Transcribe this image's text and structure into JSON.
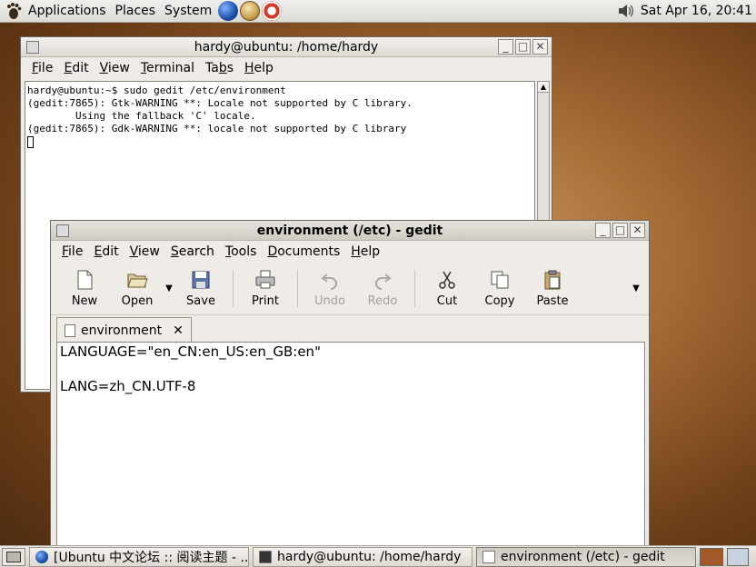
{
  "top_panel": {
    "menus": [
      "Applications",
      "Places",
      "System"
    ],
    "clock": "Sat Apr 16, 20:41"
  },
  "terminal": {
    "title": "hardy@ubuntu: /home/hardy",
    "menus": [
      {
        "label": "File",
        "key": "F",
        "rest": "ile"
      },
      {
        "label": "Edit",
        "key": "E",
        "rest": "dit"
      },
      {
        "label": "View",
        "key": "V",
        "rest": "iew"
      },
      {
        "label": "Terminal",
        "key": "T",
        "rest": "erminal"
      },
      {
        "label": "Tabs",
        "pre": "Ta",
        "key": "b",
        "rest": "s"
      },
      {
        "label": "Help",
        "key": "H",
        "rest": "elp"
      }
    ],
    "lines": [
      "hardy@ubuntu:~$ sudo gedit /etc/environment",
      "",
      "(gedit:7865): Gtk-WARNING **: Locale not supported by C library.",
      "        Using the fallback 'C' locale.",
      "",
      "(gedit:7865): Gdk-WARNING **: locale not supported by C library"
    ]
  },
  "gedit": {
    "title": "environment (/etc) - gedit",
    "menus": [
      {
        "label": "File",
        "key": "F",
        "rest": "ile"
      },
      {
        "label": "Edit",
        "key": "E",
        "rest": "dit"
      },
      {
        "label": "View",
        "key": "V",
        "rest": "iew"
      },
      {
        "label": "Search",
        "key": "S",
        "rest": "earch"
      },
      {
        "label": "Tools",
        "key": "T",
        "rest": "ools"
      },
      {
        "label": "Documents",
        "key": "D",
        "rest": "ocuments"
      },
      {
        "label": "Help",
        "key": "H",
        "rest": "elp"
      }
    ],
    "toolbar": {
      "new": "New",
      "open": "Open",
      "save": "Save",
      "print": "Print",
      "undo": "Undo",
      "redo": "Redo",
      "cut": "Cut",
      "copy": "Copy",
      "paste": "Paste"
    },
    "tab_label": "environment",
    "content": [
      "LANGUAGE=\"en_CN:en_US:en_GB:en\"",
      "",
      "LANG=zh_CN.UTF-8"
    ]
  },
  "taskbar": {
    "tasks": [
      "[Ubuntu 中文论坛 :: 阅读主题 - ...",
      "hardy@ubuntu: /home/hardy",
      "environment (/etc) - gedit"
    ]
  },
  "icons": {
    "panel": [
      "ubuntu-foot-icon",
      "web-browser-icon",
      "email-icon",
      "help-icon",
      "volume-icon"
    ]
  }
}
